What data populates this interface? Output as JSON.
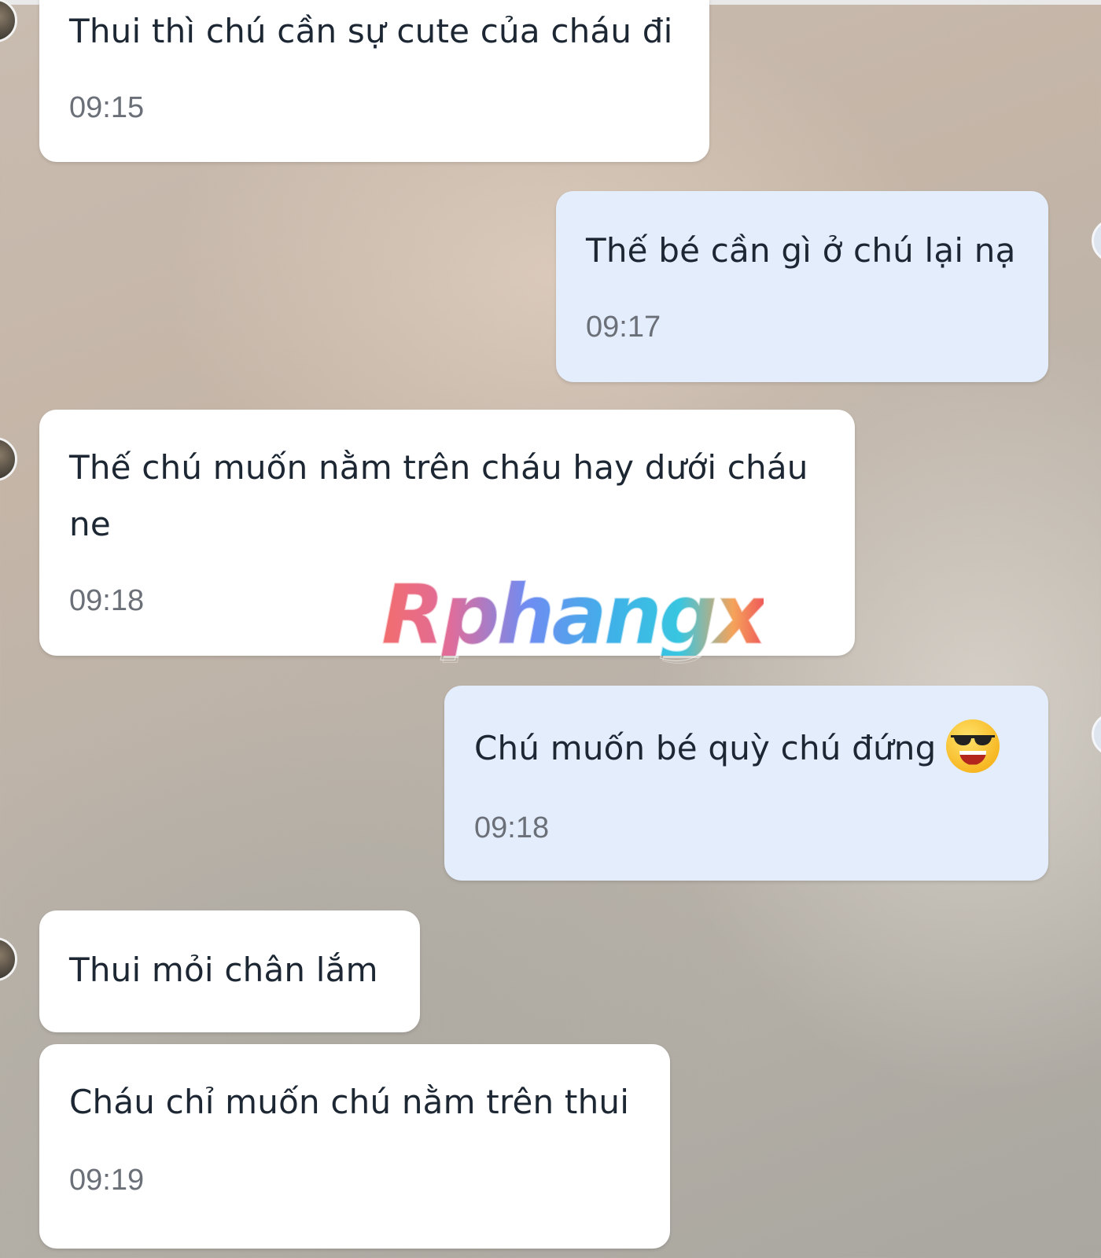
{
  "chat": {
    "messages": [
      {
        "direction": "incoming",
        "text": "Thui thì chú cần sự cute của cháu đi",
        "time": "09:15"
      },
      {
        "direction": "outgoing",
        "text": "Thế bé cần gì ở chú lại nạ",
        "time": "09:17"
      },
      {
        "direction": "incoming",
        "line1": "Thế chú muốn nằm trên cháu hay dưới cháu",
        "line2": "ne",
        "time": "09:18"
      },
      {
        "direction": "outgoing",
        "text": "Chú muốn bé quỳ chú đứng",
        "emoji": "smiling-face-with-sunglasses-emoji",
        "time": "09:18"
      },
      {
        "direction": "incoming",
        "text": "Thui mỏi chân lắm"
      },
      {
        "direction": "incoming",
        "text": "Cháu chỉ muốn chú nằm trên thui",
        "time": "09:19"
      }
    ]
  },
  "watermark": {
    "text": "Rphangx"
  },
  "colors": {
    "incoming_bubble": "#ffffff",
    "outgoing_bubble": "#e4edfc",
    "message_text": "#1c2733",
    "timestamp_text": "#6b7078"
  }
}
